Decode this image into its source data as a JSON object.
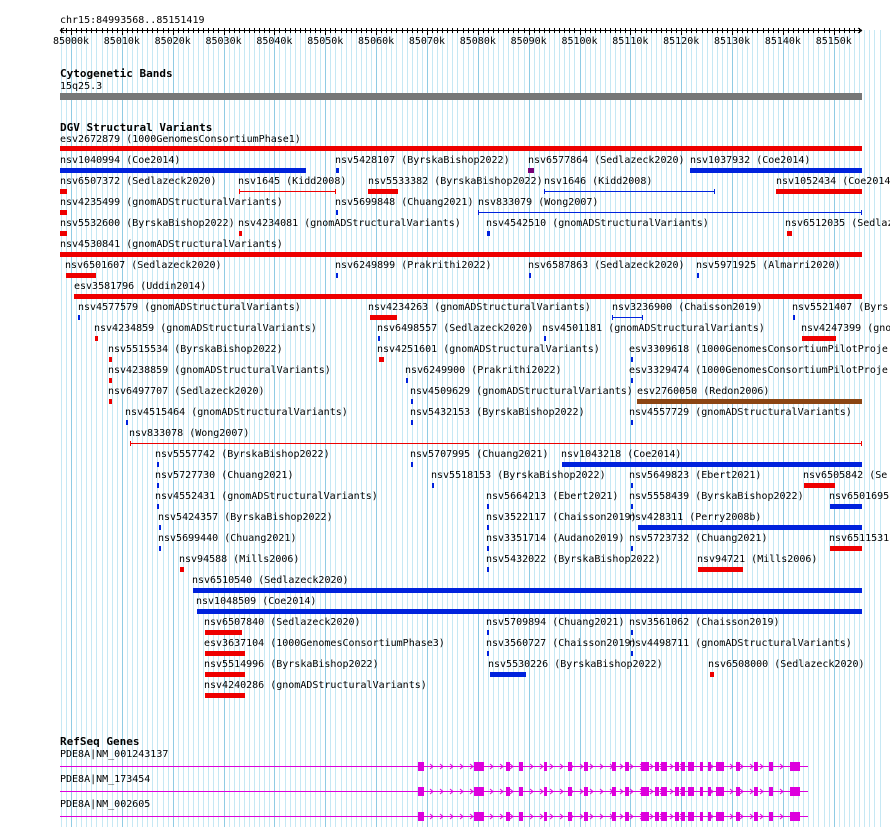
{
  "coordinate_label": "chr15:84993568..85151419",
  "ruler_ticks": [
    "85000k",
    "85010k",
    "85020k",
    "85030k",
    "85040k",
    "85050k",
    "85060k",
    "85070k",
    "85080k",
    "85090k",
    "85100k",
    "85110k",
    "85120k",
    "85130k",
    "85140k",
    "85150k"
  ],
  "colors": {
    "gain": "#ee0000",
    "loss": "#0022dd",
    "complex": "#8b4513",
    "other": "#770077",
    "gene": "#dd00dd",
    "band": "#777777",
    "grid": "#b0e0f0"
  },
  "cytoband": {
    "title": "Cytogenetic Bands",
    "band_name": "15q25.3"
  },
  "dgv": {
    "title": "DGV Structural Variants",
    "variants": [
      "esv2672879 (1000GenomesConsortiumPhase1)",
      "nsv1040994 (Coe2014)",
      "nsv5428107 (ByrskaBishop2022)",
      "nsv6577864 (Sedlazeck2020)",
      "nsv1037932 (Coe2014)",
      "nsv6507372 (Sedlazeck2020)",
      "nsv1645 (Kidd2008)",
      "nsv5533382 (ByrskaBishop2022)",
      "nsv1646 (Kidd2008)",
      "nsv1052434 (Coe2014)",
      "nsv4235499 (gnomADStructuralVariants)",
      "nsv5699848 (Chuang2021)",
      "nsv833079 (Wong2007)",
      "nsv5532600 (ByrskaBishop2022)",
      "nsv4234081 (gnomADStructuralVariants)",
      "nsv4542510 (gnomADStructuralVariants)",
      "nsv6512035 (Sedlaz",
      "nsv4530841 (gnomADStructuralVariants)",
      "nsv6501607 (Sedlazeck2020)",
      "nsv6249899 (Prakrithi2022)",
      "nsv6587863 (Sedlazeck2020)",
      "nsv5971925 (Almarri2020)",
      "esv3581796 (Uddin2014)",
      "nsv4577579 (gnomADStructuralVariants)",
      "nsv4234263 (gnomADStructuralVariants)",
      "nsv3236900 (Chaisson2019)",
      "nsv5521407 (Byrs",
      "nsv4234859 (gnomADStructuralVariants)",
      "nsv6498557 (Sedlazeck2020)",
      "nsv4501181 (gnomADStructuralVariants)",
      "nsv4247399 (gno",
      "nsv5515534 (ByrskaBishop2022)",
      "nsv4251601 (gnomADStructuralVariants)",
      "esv3309618 (1000GenomesConsortiumPilotProje",
      "nsv4238859 (gnomADStructuralVariants)",
      "nsv6249900 (Prakrithi2022)",
      "esv3329474 (1000GenomesConsortiumPilotProje",
      "nsv6497707 (Sedlazeck2020)",
      "nsv4509629 (gnomADStructuralVariants)",
      "esv2760050 (Redon2006)",
      "nsv4515464 (gnomADStructuralVariants)",
      "nsv5432153 (ByrskaBishop2022)",
      "nsv4557729 (gnomADStructuralVariants)",
      "nsv833078 (Wong2007)",
      "nsv5557742 (ByrskaBishop2022)",
      "nsv5707995 (Chuang2021)",
      "nsv1043218 (Coe2014)",
      "nsv5727730 (Chuang2021)",
      "nsv5518153 (ByrskaBishop2022)",
      "nsv5649823 (Ebert2021)",
      "nsv6505842 (Se",
      "nsv4552431 (gnomADStructuralVariants)",
      "nsv5664213 (Ebert2021)",
      "nsv5558439 (ByrskaBishop2022)",
      "nsv6501695",
      "nsv5424357 (ByrskaBishop2022)",
      "nsv3522117 (Chaisson2019)",
      "nsv428311 (Perry2008b)",
      "nsv5699440 (Chuang2021)",
      "nsv3351714 (Audano2019)",
      "nsv5723732 (Chuang2021)",
      "nsv6511531",
      "nsv94588 (Mills2006)",
      "nsv5432022 (ByrskaBishop2022)",
      "nsv94721 (Mills2006)",
      "nsv6510540 (Sedlazeck2020)",
      "nsv1048509 (Coe2014)",
      "nsv6507840 (Sedlazeck2020)",
      "nsv5709894 (Chuang2021)",
      "nsv3561062 (Chaisson2019)",
      "esv3637104 (1000GenomesConsortiumPhase3)",
      "nsv3560727 (Chaisson2019)",
      "nsv4498711 (gnomADStructuralVariants)",
      "nsv5514996 (ByrskaBishop2022)",
      "nsv5530226 (ByrskaBishop2022)",
      "nsv6508000 (Sedlazeck2020)",
      "nsv4240286 (gnomADStructuralVariants)"
    ]
  },
  "refseq": {
    "title": "RefSeq Genes",
    "genes": [
      "PDE8A|NM_001243137",
      "PDE8A|NM_173454",
      "PDE8A|NM_002605"
    ]
  }
}
